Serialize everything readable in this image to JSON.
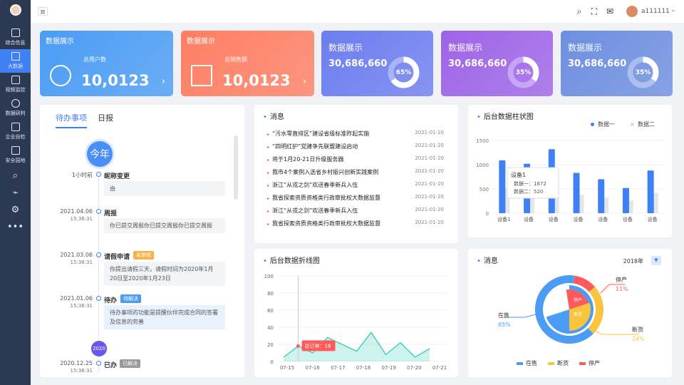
{
  "sidebar": {
    "items": [
      {
        "label": "综合信息",
        "icon": "document-icon"
      },
      {
        "label": "大数据",
        "icon": "bar-chart-icon",
        "active": true
      },
      {
        "label": "视频监控",
        "icon": "monitor-icon"
      },
      {
        "label": "数据研判",
        "icon": "globe-icon"
      },
      {
        "label": "企业自检",
        "icon": "ticket-icon"
      },
      {
        "label": "安全园地",
        "icon": "shield-icon"
      }
    ],
    "bottom_icons": [
      "search-icon",
      "share-icon",
      "gear-icon",
      "more-icon"
    ]
  },
  "topbar": {
    "username": "a111111"
  },
  "cards": [
    {
      "title": "数据展示",
      "subtitle": "总用户数",
      "value": "10,0123",
      "color": "#4a9cf5"
    },
    {
      "title": "数据展示",
      "subtitle": "总销售额",
      "value": "10,0123",
      "color": "#ff7e63"
    },
    {
      "title": "数据展示",
      "value": "30,686,660",
      "percent": 65,
      "percent_label": "65%",
      "color": "#6c7df0"
    },
    {
      "title": "数据展示",
      "value": "30,686,660",
      "percent": 35,
      "percent_label": "35%",
      "color": "#9e63e8"
    },
    {
      "title": "数据展示",
      "value": "30,686,660",
      "percent": 35,
      "percent_label": "35%",
      "color": "#6d8ee0"
    }
  ],
  "todo": {
    "tabs": [
      "待办事项",
      "日报"
    ],
    "year_label": "今年",
    "year2020": "2020",
    "items": [
      {
        "date": "1小时前",
        "time": "",
        "label": "昵称变更",
        "tag": "",
        "detail": "由"
      },
      {
        "date": "2021.04.06",
        "time": "15:36:31",
        "label": "周报",
        "tag": "",
        "detail": "你已提交周报你已提交周报你已提交周报"
      },
      {
        "date": "2021.03.06",
        "time": "15:36:31",
        "label": "请假申请",
        "tag": "未审核",
        "detail": "你提出请假三天，请假时间为2020年1月20日至2020年1月23日"
      },
      {
        "date": "2021.01.06",
        "time": "15:36:31",
        "label": "待办",
        "tag": "待解决",
        "detail": "待办事项的功能是提醒伙伴完成合同的签署及信息的完善"
      },
      {
        "date": "2020.12.25",
        "time": "15:36:31",
        "label": "已办",
        "tag": "已解决",
        "detail": ""
      }
    ]
  },
  "messages": {
    "title": "消息",
    "items": [
      {
        "text": "“污水零直排区”建设省级标准昨起实施",
        "date": "2021-01-20"
      },
      {
        "text": "“四明红护”党建争先联盟建设启动",
        "date": "2021-01-20"
      },
      {
        "text": "将于1月20-21日升级服务器",
        "date": "2021-01-20"
      },
      {
        "text": "我市4个案例入选省乡村振兴创新实践案例",
        "date": "2021-01-20"
      },
      {
        "text": "浙江“从戎之剑”欢送春季新兵入伍",
        "date": "2021-01-20"
      },
      {
        "text": "我省探索资质资格类行政审批权大数据监督",
        "date": "2021-01-20"
      },
      {
        "text": "浙江“从戎之剑”欢送春季新兵入伍",
        "date": "2021-01-20"
      },
      {
        "text": "我省探索资质资格类行政审批权大数据监督",
        "date": "2021-01-20"
      }
    ]
  },
  "chart_data": [
    {
      "type": "bar",
      "title": "后台数据柱状图",
      "categories": [
        "设备1",
        "设备",
        "设备",
        "设备",
        "设备",
        "设备",
        "设备"
      ],
      "series": [
        {
          "name": "数据一",
          "values": [
            1090,
            1020,
            1320,
            830,
            700,
            520,
            880
          ]
        },
        {
          "name": "数据二",
          "values": [
            520,
            460,
            560,
            380,
            320,
            260,
            420
          ]
        }
      ],
      "ylim": [
        0,
        1500
      ],
      "yticks": [
        "0",
        "500",
        "1000",
        "1500"
      ],
      "tooltip": {
        "title": "设备1",
        "lines": [
          "数据一：1672",
          "数据二：520"
        ]
      }
    },
    {
      "type": "area",
      "title": "后台数据折线图",
      "x": [
        "07-15",
        "07-16",
        "07-17",
        "07-18",
        "07-19",
        "07-20",
        "07-21"
      ],
      "values": [
        5,
        18,
        10,
        28,
        20,
        12,
        34,
        8,
        22,
        5,
        15
      ],
      "ylim": [
        0,
        100
      ],
      "yticks": [
        "0",
        "20",
        "40",
        "60",
        "80",
        "100"
      ],
      "tooltip": "总订单：18"
    },
    {
      "type": "pie",
      "title": "消息",
      "year": "2018年",
      "series": [
        {
          "name": "在售",
          "value": 65,
          "label": "65%",
          "color": "#4a9cf5"
        },
        {
          "name": "断货",
          "value": 24,
          "label": "24%",
          "color": "#f8c53c"
        },
        {
          "name": "停产",
          "value": 11,
          "label": "11%",
          "color": "#ff5b5b"
        }
      ],
      "inner_labels": [
        "在售",
        "停产",
        "断货"
      ]
    }
  ]
}
